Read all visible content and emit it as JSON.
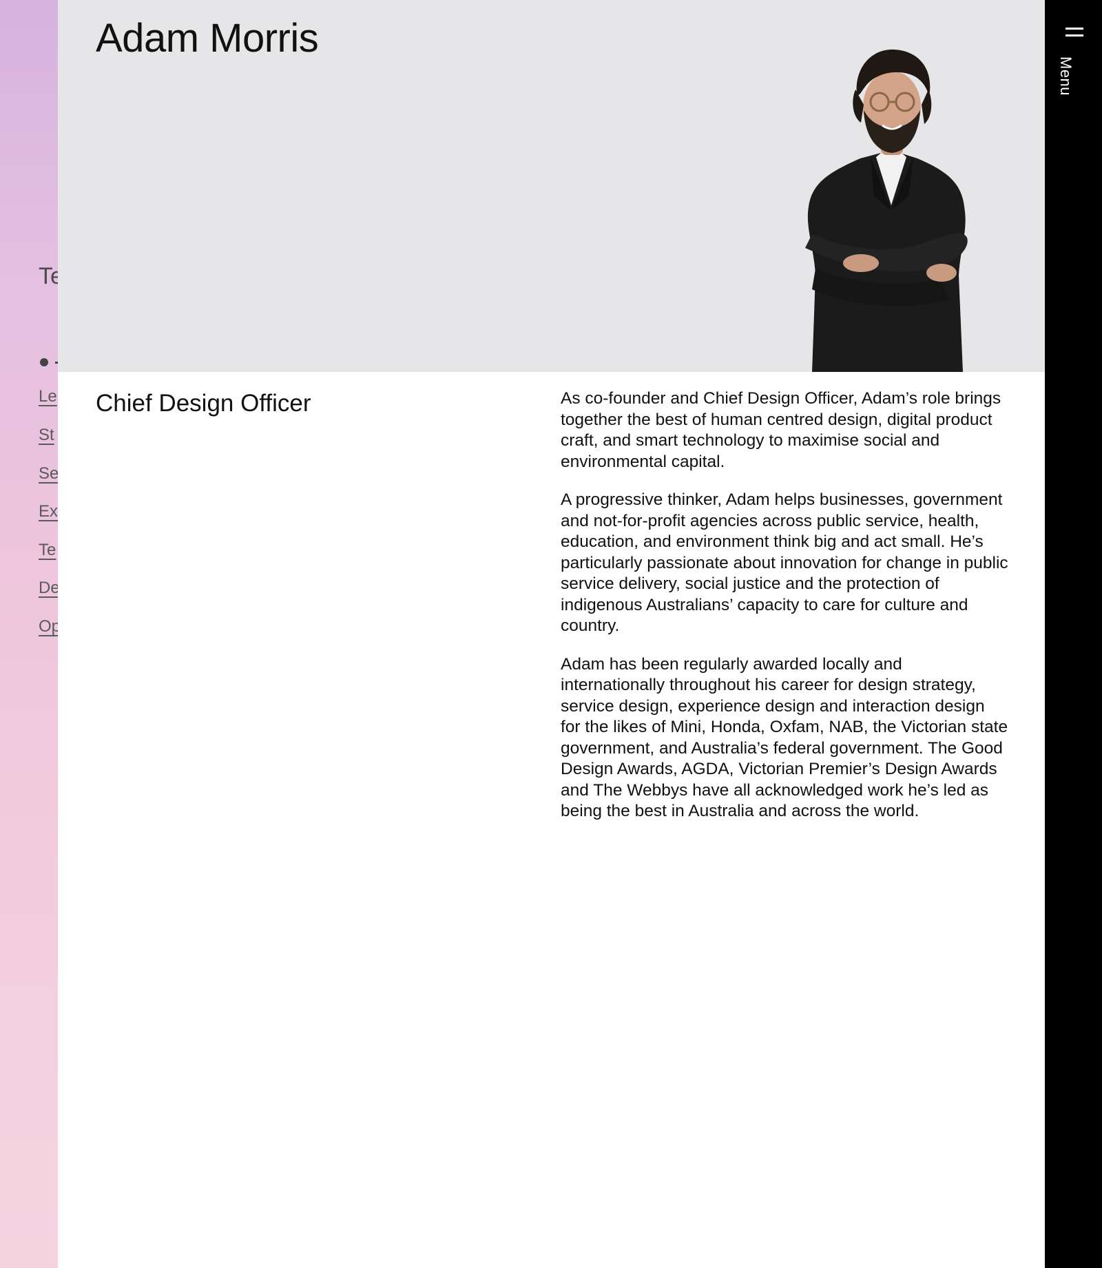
{
  "background_page": {
    "title_fragment": "Te",
    "links": [
      "Le",
      "St",
      "Se",
      "Ex",
      "Te",
      "De",
      "Op"
    ]
  },
  "profile": {
    "name": "Adam Morris",
    "role": "Chief Design Officer",
    "bio": [
      "As co-founder and Chief Design Officer, Adam’s role brings together the best of human centred design, digital product craft, and smart technology to maximise social and environmental capital.",
      "A progressive thinker, Adam helps businesses, government and not-for-profit agencies across public service, health, education, and environment think big and act small. He’s particularly passionate about innovation for change in public service delivery, social justice and the protection of indigenous Australians’ capacity to care for culture and country.",
      "Adam has been regularly awarded locally and internationally throughout his career for design strategy, service design, experience design and interaction design for the likes of Mini, Honda, Oxfam, NAB, the Victorian state government, and Australia’s federal government. The Good Design Awards, AGDA, Victorian Premier’s Design Awards and The Webbys have all acknowledged work he’s led as being the best in Australia and across the world."
    ]
  },
  "menu": {
    "label": "Menu",
    "icon": "hamburger-icon"
  },
  "colors": {
    "hero_bg": "#e6e6e8",
    "menubar_bg": "#000000",
    "gradient_top": "#d6b3de",
    "gradient_bottom": "#f4d3df"
  }
}
